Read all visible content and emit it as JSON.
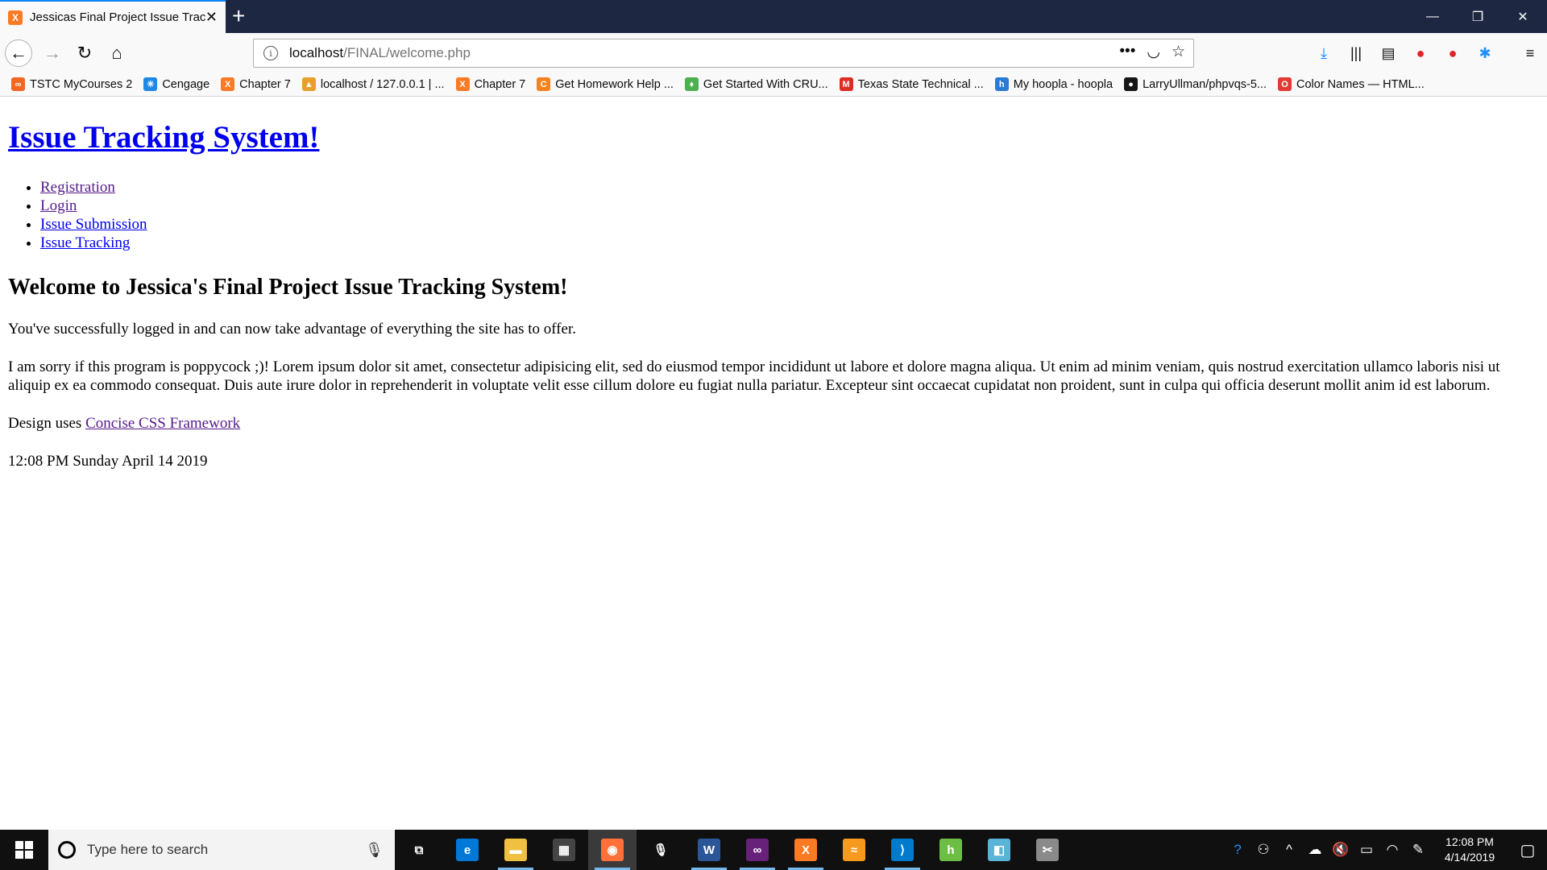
{
  "browser": {
    "tab_title": "Jessicas Final Project Issue Tracking System",
    "tab_favicon": "xampp-icon",
    "url_host": "localhost",
    "url_path": "/FINAL/welcome.php",
    "bookmarks": [
      {
        "label": "TSTC MyCourses 2",
        "icon": "tstc-icon",
        "color": "#f26722",
        "glyph": "∞"
      },
      {
        "label": "Cengage",
        "icon": "cengage-icon",
        "color": "#1e88e5",
        "glyph": "✳"
      },
      {
        "label": "Chapter 7",
        "icon": "xampp-icon",
        "color": "#fb7a24",
        "glyph": "X"
      },
      {
        "label": "localhost / 127.0.0.1 | ...",
        "icon": "phpmyadmin-icon",
        "color": "#e8a02d",
        "glyph": "▲"
      },
      {
        "label": "Chapter 7",
        "icon": "xampp-icon",
        "color": "#fb7a24",
        "glyph": "X"
      },
      {
        "label": "Get Homework Help ...",
        "icon": "chegg-icon",
        "color": "#f5821f",
        "glyph": "C"
      },
      {
        "label": "Get Started With CRU...",
        "icon": "leaf-icon",
        "color": "#4caf50",
        "glyph": "♦"
      },
      {
        "label": "Texas State Technical ...",
        "icon": "gmail-icon",
        "color": "#d93025",
        "glyph": "M"
      },
      {
        "label": "My hoopla - hoopla",
        "icon": "hoopla-icon",
        "color": "#2b7cd3",
        "glyph": "h"
      },
      {
        "label": "LarryUllman/phpvqs-5...",
        "icon": "github-icon",
        "color": "#181717",
        "glyph": "●"
      },
      {
        "label": "Color Names — HTML...",
        "icon": "opera-icon",
        "color": "#e53935",
        "glyph": "O"
      }
    ]
  },
  "page": {
    "site_title": "Issue Tracking System!",
    "nav": [
      {
        "label": "Registration",
        "visited": true
      },
      {
        "label": "Login",
        "visited": true
      },
      {
        "label": "Issue Submission",
        "visited": false
      },
      {
        "label": "Issue Tracking",
        "visited": false
      }
    ],
    "heading": "Welcome to Jessica's Final Project Issue Tracking System!",
    "logged_in_text": "You've successfully logged in and can now take advantage of everything the site has to offer.",
    "lorem_text": "I am sorry if this program is poppycock ;)! Lorem ipsum dolor sit amet, consectetur adipisicing elit, sed do eiusmod tempor incididunt ut labore et dolore magna aliqua. Ut enim ad minim veniam, quis nostrud exercitation ullamco laboris nisi ut aliquip ex ea commodo consequat. Duis aute irure dolor in reprehenderit in voluptate velit esse cillum dolore eu fugiat nulla pariatur. Excepteur sint occaecat cupidatat non proident, sunt in culpa qui officia deserunt mollit anim id est laborum.",
    "design_prefix": "Design uses",
    "design_link": "Concise CSS Framework",
    "datetime": "12:08 PM Sunday April 14 2019"
  },
  "taskbar": {
    "search_placeholder": "Type here to search",
    "apps": [
      {
        "name": "task-view-icon",
        "color": "#101010",
        "glyph": "⧉",
        "active": false,
        "open": false
      },
      {
        "name": "edge-icon",
        "color": "#0078d7",
        "glyph": "e",
        "active": false,
        "open": false
      },
      {
        "name": "file-explorer-icon",
        "color": "#f0c040",
        "glyph": "▬",
        "active": false,
        "open": true
      },
      {
        "name": "store-icon",
        "color": "#444444",
        "glyph": "▦",
        "active": false,
        "open": false
      },
      {
        "name": "firefox-icon",
        "color": "#ff7139",
        "glyph": "◉",
        "active": true,
        "open": true
      },
      {
        "name": "voice-recorder-icon",
        "color": "#101010",
        "glyph": "🎙",
        "active": false,
        "open": false
      },
      {
        "name": "word-icon",
        "color": "#2b579a",
        "glyph": "W",
        "active": false,
        "open": true
      },
      {
        "name": "visual-studio-icon",
        "color": "#68217a",
        "glyph": "∞",
        "active": false,
        "open": true
      },
      {
        "name": "xampp-icon",
        "color": "#fb7a24",
        "glyph": "X",
        "active": false,
        "open": true
      },
      {
        "name": "audible-icon",
        "color": "#f7991c",
        "glyph": "≈",
        "active": false,
        "open": false
      },
      {
        "name": "vscode-icon",
        "color": "#007acc",
        "glyph": "⟩",
        "active": false,
        "open": true
      },
      {
        "name": "hoopla-app-icon",
        "color": "#6dbe45",
        "glyph": "h",
        "active": false,
        "open": false
      },
      {
        "name": "notepad-icon",
        "color": "#5ab4d8",
        "glyph": "◧",
        "active": false,
        "open": false
      },
      {
        "name": "snipping-icon",
        "color": "#8a8a8a",
        "glyph": "✂",
        "active": false,
        "open": false
      }
    ],
    "clock_time": "12:08 PM",
    "clock_date": "4/14/2019"
  },
  "colors": {
    "tabbar": "#1e2742",
    "link": "#0000ee",
    "visited_link": "#551a8b",
    "taskbar": "#101010"
  }
}
